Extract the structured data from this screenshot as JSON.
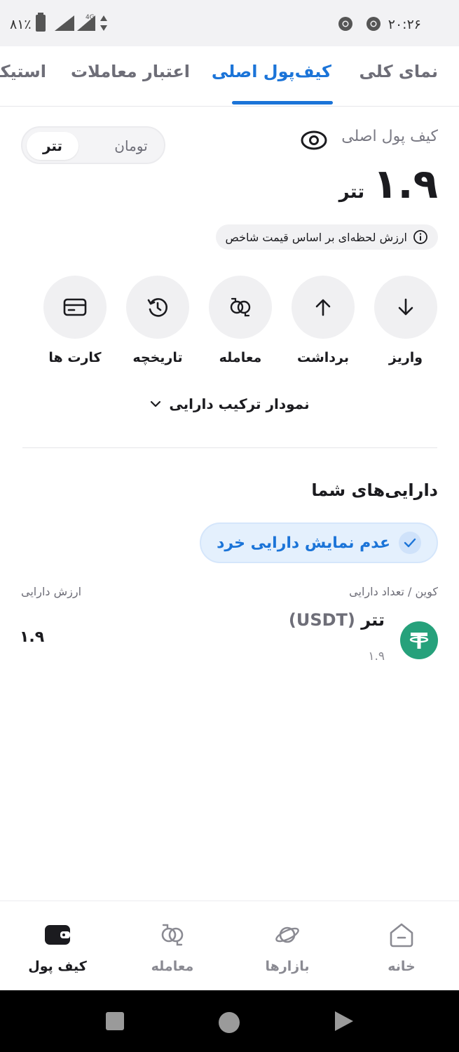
{
  "status_bar": {
    "battery_text": "۸۱٪",
    "time": "۲۰:۲۶",
    "network_label": "4G"
  },
  "tabs": [
    {
      "label": "نمای کلی",
      "active": false
    },
    {
      "label": "کیف‌پول اصلی",
      "active": true
    },
    {
      "label": "اعتبار معاملات",
      "active": false
    },
    {
      "label": "استیکینگ",
      "active": false
    }
  ],
  "wallet": {
    "title": "کیف پول اصلی",
    "toggle": {
      "selected": "تتر",
      "other": "تومان"
    },
    "balance_value": "۱.۹",
    "balance_unit": "تتر",
    "price_note": "ارزش لحظه‌ای بر اساس قیمت شاخص"
  },
  "actions": [
    {
      "label": "واریز",
      "icon": "arrow-down-icon"
    },
    {
      "label": "برداشت",
      "icon": "arrow-up-icon"
    },
    {
      "label": "معامله",
      "icon": "exchange-icon"
    },
    {
      "label": "تاریخچه",
      "icon": "history-icon"
    },
    {
      "label": "کارت ها",
      "icon": "card-icon"
    }
  ],
  "composition_label": "نمودار ترکیب دارایی",
  "assets": {
    "title": "دارایی‌های شما",
    "hide_small_label": "عدم نمایش دارایی خرد",
    "col_coin": "کوین / تعداد دارایی",
    "col_value": "ارزش دارایی",
    "items": [
      {
        "name": "تتر",
        "symbol": "(USDT)",
        "quantity": "۱.۹",
        "value": "۱.۹",
        "color": "#26a17b"
      }
    ]
  },
  "bottom_nav": [
    {
      "label": "خانه",
      "icon": "home-icon",
      "active": false
    },
    {
      "label": "بازارها",
      "icon": "planet-icon",
      "active": false
    },
    {
      "label": "معامله",
      "icon": "exchange-icon",
      "active": false
    },
    {
      "label": "کیف پول",
      "icon": "wallet-icon",
      "active": true
    }
  ],
  "colors": {
    "accent": "#1b74d8",
    "tether": "#26a17b",
    "text": "#1b1b1f",
    "muted": "#6e6e78"
  }
}
